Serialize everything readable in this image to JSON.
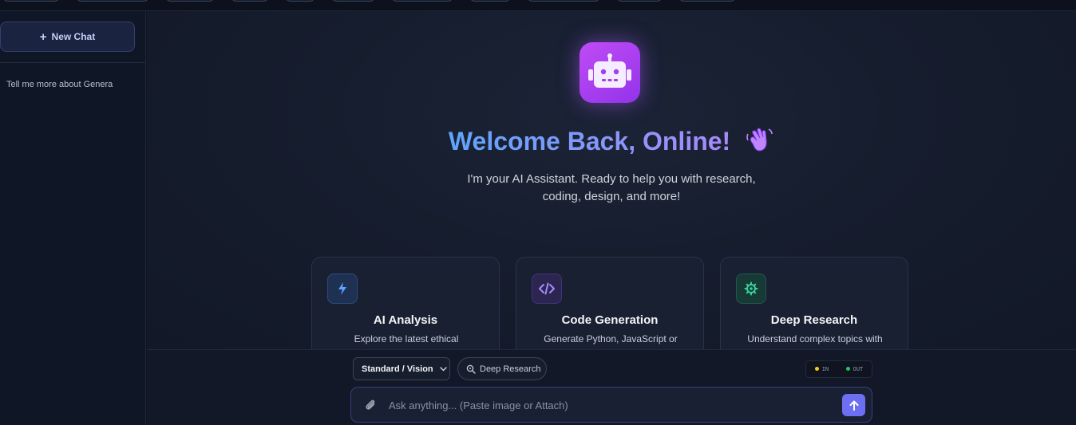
{
  "sidebar": {
    "new_chat_label": "New Chat",
    "history": [
      {
        "title": "Tell me more about Genera"
      }
    ]
  },
  "welcome": {
    "title": "Welcome Back, Online!",
    "subtitle": "I'm your AI Assistant. Ready to help you with research, coding, design, and more!"
  },
  "cards": [
    {
      "title": "AI Analysis",
      "description": "Explore the latest ethical",
      "icon": "bolt-icon",
      "color": "#60a5fa"
    },
    {
      "title": "Code Generation",
      "description": "Generate Python, JavaScript or",
      "icon": "code-icon",
      "color": "#a78bfa"
    },
    {
      "title": "Deep Research",
      "description": "Understand complex topics with",
      "icon": "gear-icon",
      "color": "#34d399"
    }
  ],
  "composer": {
    "model_label": "Standard / Vision",
    "deep_research_label": "Deep Research",
    "io_in_label": "IN",
    "io_out_label": "OUT",
    "placeholder": "Ask anything... (Paste image or Attach)"
  },
  "colors": {
    "accent": "#6d6ff2",
    "brand_purple": "#a855f7",
    "in_indicator": "#facc15",
    "out_indicator": "#22c55e"
  }
}
